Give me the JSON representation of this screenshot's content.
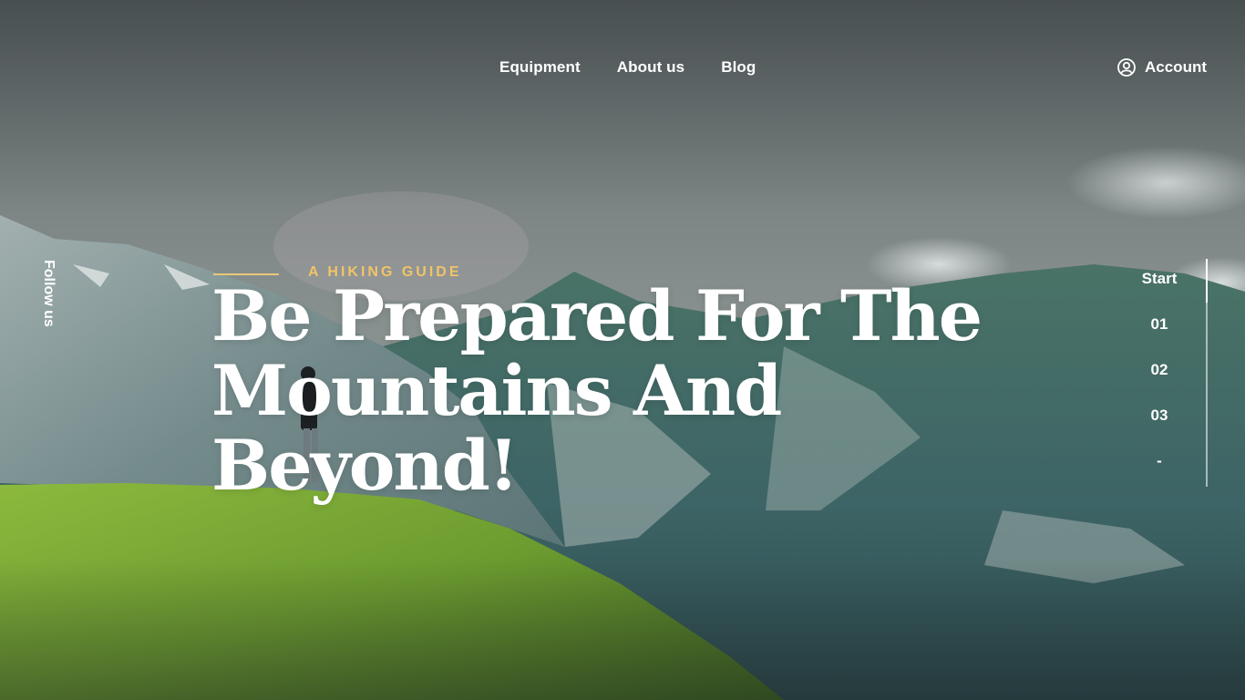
{
  "nav": {
    "links": [
      "Equipment",
      "About us",
      "Blog"
    ],
    "account_label": "Account"
  },
  "social": {
    "follow_label": "Follow us"
  },
  "hero": {
    "eyebrow": "A HIKING GUIDE",
    "headline_line1": "Be Prepared For The",
    "headline_line2": "Mountains And Beyond!"
  },
  "slider": {
    "steps": [
      "Start",
      "01",
      "02",
      "03",
      "-"
    ],
    "active_step": "Start"
  },
  "colors": {
    "accent": "#F0C468",
    "text": "#FFFFFF",
    "grass": "#7FAE3A"
  },
  "icons": {
    "account": "user-circle-icon"
  }
}
